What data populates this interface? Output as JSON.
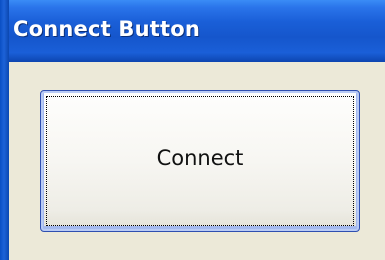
{
  "window": {
    "title": "Connect Button"
  },
  "main": {
    "connect_label": "Connect"
  },
  "colors": {
    "title_bar": "#1556cc",
    "client_background": "#ece9d8",
    "button_border": "#2f4fb0"
  }
}
